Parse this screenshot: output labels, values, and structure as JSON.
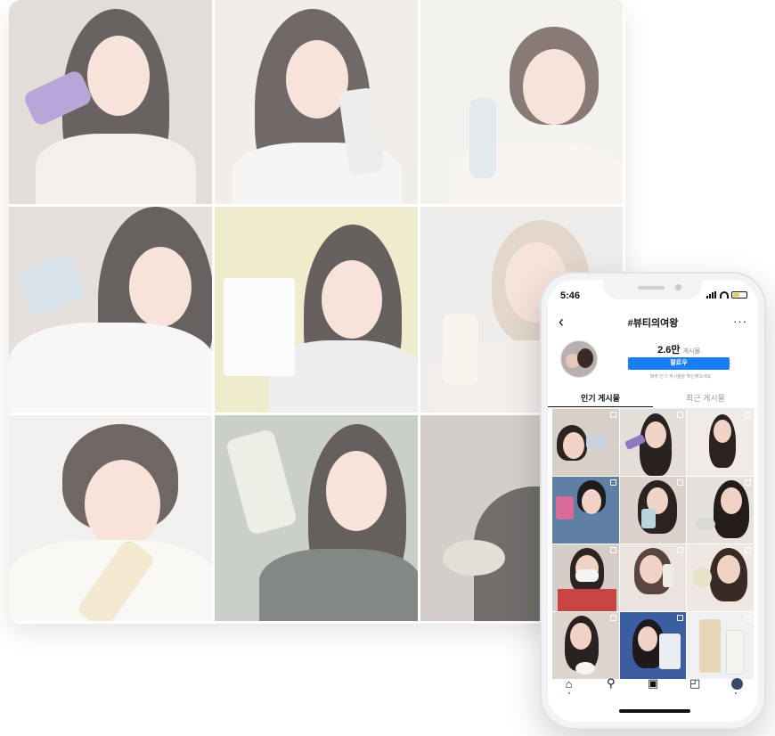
{
  "phone": {
    "status_time": "5:46",
    "nav_title": "#뷰티의여왕",
    "post_count": "2.6만",
    "post_count_label": "게시물",
    "follow_label": "팔로우",
    "subtext": "매주 인기 게시물을 확인해보세요",
    "tabs": [
      "인기 게시물",
      "최근 게시물"
    ],
    "icons": {
      "back": "chevron-left-icon",
      "more": "more-horizontal-icon",
      "home": "home-icon",
      "search": "search-icon",
      "reels": "reels-icon",
      "shop": "shop-icon",
      "profile": "profile-avatar-icon"
    }
  },
  "colors": {
    "follow_button": "#1a7ef2",
    "battery": "#f2c94c",
    "notification_dot": "#e1306c"
  }
}
